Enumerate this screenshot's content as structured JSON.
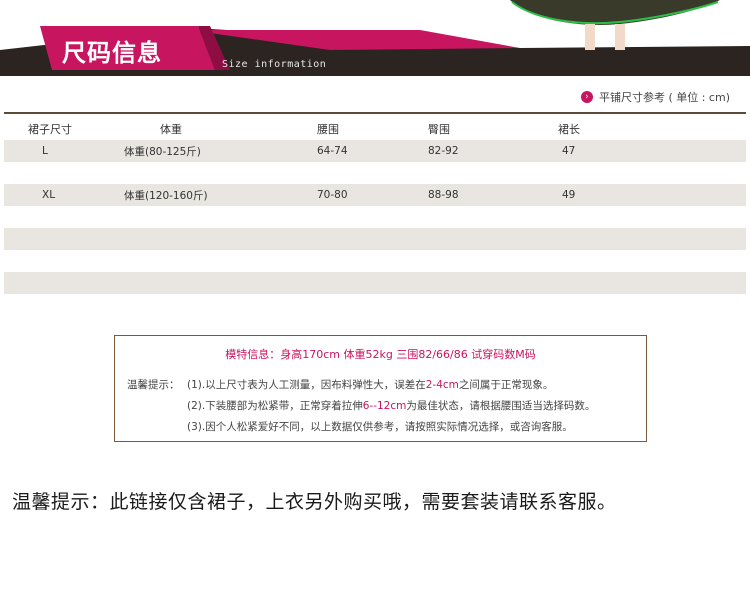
{
  "header": {
    "title": "尺码信息",
    "subtitle": "Size information",
    "colors": {
      "band": "#2b2421",
      "accent": "#c8155f"
    }
  },
  "reference": {
    "icon": "chevron-right-icon",
    "text": "平铺尺寸参考 ( 单位 : cm)"
  },
  "table": {
    "headers": [
      "裙子尺寸",
      "体重",
      "腰围",
      "臀围",
      "裙长"
    ],
    "rows": [
      [
        "L",
        "体重(80-125斤)",
        "64-74",
        "82-92",
        "47"
      ],
      [
        "XL",
        "体重(120-160斤)",
        "70-80",
        "88-98",
        "49"
      ]
    ]
  },
  "notice": {
    "model_info": "模特信息：身高170cm  体重52kg  三围82/66/86  试穿码数M码",
    "label": "温馨提示：",
    "tip1_a": "(1).以上尺寸表为人工测量，因布料弹性大，误差在",
    "tip1_hl": "2-4cm",
    "tip1_b": "之间属于正常现象。",
    "tip2_a": "(2).下装腰部为松紧带，正常穿着拉伸",
    "tip2_hl": "6--12cm",
    "tip2_b": "为最佳状态，请根据腰围适当选择码数。",
    "tip3": "(3).因个人松紧爱好不同，以上数据仅供参考，请按照实际情况选择，或咨询客服。"
  },
  "bottom_note": "温馨提示：此链接仅含裙子，上衣另外购买哦，需要套装请联系客服。"
}
